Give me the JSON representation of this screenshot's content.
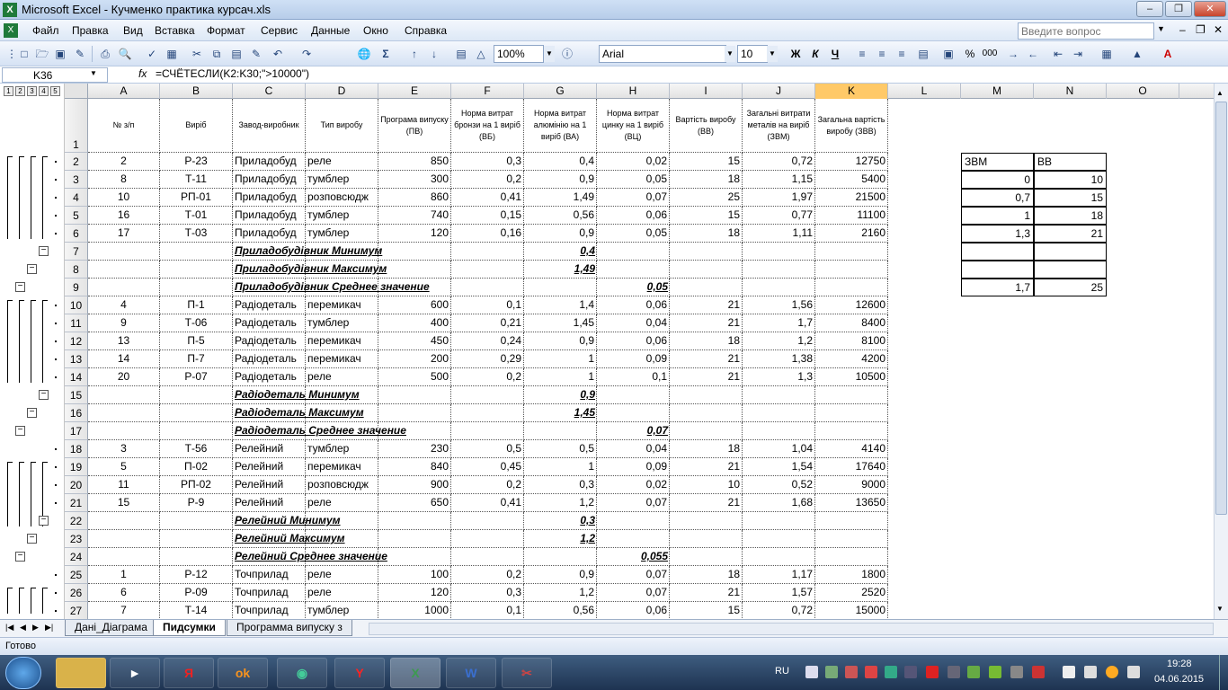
{
  "window": {
    "title": "Microsoft Excel - Кучменко практика курсач.xls",
    "app_icon": "X"
  },
  "menu": [
    "Файл",
    "Правка",
    "Вид",
    "Вставка",
    "Формат",
    "Сервис",
    "Данные",
    "Окно",
    "Справка"
  ],
  "help": {
    "placeholder": "Введите вопрос"
  },
  "toolbar": {
    "zoom": "100%",
    "font": "Arial",
    "size": "10",
    "bold": "Ж",
    "italic": "К",
    "underline": "Ч",
    "percent": "%",
    "thousands": "000"
  },
  "formula_bar": {
    "cell": "K36",
    "fx": "fx",
    "formula": "=СЧЁТЕСЛИ(K2:K30;\">10000\")"
  },
  "outline_levels": [
    "1",
    "2",
    "3",
    "4",
    "5"
  ],
  "columns": [
    "A",
    "B",
    "C",
    "D",
    "E",
    "F",
    "G",
    "H",
    "I",
    "J",
    "K",
    "L",
    "M",
    "N",
    "O"
  ],
  "header_row": [
    "№      з/п",
    "Виріб",
    "Завод-виробник",
    "Тип виробу",
    "Програма випуску (ПВ)",
    "Норма витрат бронзи на 1 виріб (ВБ)",
    "Норма витрат алюмінію на 1 виріб (ВА)",
    "Норма витрат цинку на 1 виріб (ВЦ)",
    "Вартість виробу (ВВ)",
    "Загальні витрати металів на виріб (ЗВМ)",
    "Загальна вартість виробу (ЗВВ)"
  ],
  "rows": [
    {
      "n": "2",
      "t": "d",
      "v": [
        "2",
        "Р-23",
        "Приладобуд",
        "реле",
        "850",
        "0,3",
        "0,4",
        "0,02",
        "15",
        "0,72",
        "12750"
      ]
    },
    {
      "n": "3",
      "t": "d",
      "v": [
        "8",
        "Т-11",
        "Приладобуд",
        "тумблер",
        "300",
        "0,2",
        "0,9",
        "0,05",
        "18",
        "1,15",
        "5400"
      ]
    },
    {
      "n": "4",
      "t": "d",
      "v": [
        "10",
        "РП-01",
        "Приладобуд",
        "розповсюдж",
        "860",
        "0,41",
        "1,49",
        "0,07",
        "25",
        "1,97",
        "21500"
      ]
    },
    {
      "n": "5",
      "t": "d",
      "v": [
        "16",
        "Т-01",
        "Приладобуд",
        "тумблер",
        "740",
        "0,15",
        "0,56",
        "0,06",
        "15",
        "0,77",
        "11100"
      ]
    },
    {
      "n": "6",
      "t": "d",
      "v": [
        "17",
        "Т-03",
        "Приладобуд",
        "тумблер",
        "120",
        "0,16",
        "0,9",
        "0,05",
        "18",
        "1,11",
        "2160"
      ]
    },
    {
      "n": "7",
      "t": "s",
      "label": "Приладобудівник Минимум",
      "col": "G",
      "val": "0,4"
    },
    {
      "n": "8",
      "t": "s",
      "label": "Приладобудівник Максимум",
      "col": "G",
      "val": "1,49"
    },
    {
      "n": "9",
      "t": "s",
      "label": "Приладобудівник Среднее значение",
      "col": "H",
      "val": "0,05"
    },
    {
      "n": "10",
      "t": "d",
      "v": [
        "4",
        "П-1",
        "Радіодеталь",
        "перемикач",
        "600",
        "0,1",
        "1,4",
        "0,06",
        "21",
        "1,56",
        "12600"
      ]
    },
    {
      "n": "11",
      "t": "d",
      "v": [
        "9",
        "Т-06",
        "Радіодеталь",
        "тумблер",
        "400",
        "0,21",
        "1,45",
        "0,04",
        "21",
        "1,7",
        "8400"
      ]
    },
    {
      "n": "12",
      "t": "d",
      "v": [
        "13",
        "П-5",
        "Радіодеталь",
        "перемикач",
        "450",
        "0,24",
        "0,9",
        "0,06",
        "18",
        "1,2",
        "8100"
      ]
    },
    {
      "n": "13",
      "t": "d",
      "v": [
        "14",
        "П-7",
        "Радіодеталь",
        "перемикач",
        "200",
        "0,29",
        "1",
        "0,09",
        "21",
        "1,38",
        "4200"
      ]
    },
    {
      "n": "14",
      "t": "d",
      "v": [
        "20",
        "Р-07",
        "Радіодеталь",
        "реле",
        "500",
        "0,2",
        "1",
        "0,1",
        "21",
        "1,3",
        "10500"
      ]
    },
    {
      "n": "15",
      "t": "s",
      "label": "Радіодеталь Минимум",
      "col": "G",
      "val": "0,9"
    },
    {
      "n": "16",
      "t": "s",
      "label": "Радіодеталь Максимум",
      "col": "G",
      "val": "1,45"
    },
    {
      "n": "17",
      "t": "s",
      "label": "Радіодеталь Среднее значение",
      "col": "H",
      "val": "0,07"
    },
    {
      "n": "18",
      "t": "d",
      "v": [
        "3",
        "Т-56",
        "Релейний",
        "тумблер",
        "230",
        "0,5",
        "0,5",
        "0,04",
        "18",
        "1,04",
        "4140"
      ]
    },
    {
      "n": "19",
      "t": "d",
      "v": [
        "5",
        "П-02",
        "Релейний",
        "перемикач",
        "840",
        "0,45",
        "1",
        "0,09",
        "21",
        "1,54",
        "17640"
      ]
    },
    {
      "n": "20",
      "t": "d",
      "v": [
        "11",
        "РП-02",
        "Релейний",
        "розповсюдж",
        "900",
        "0,2",
        "0,3",
        "0,02",
        "10",
        "0,52",
        "9000"
      ]
    },
    {
      "n": "21",
      "t": "d",
      "v": [
        "15",
        "Р-9",
        "Релейний",
        "реле",
        "650",
        "0,41",
        "1,2",
        "0,07",
        "21",
        "1,68",
        "13650"
      ]
    },
    {
      "n": "22",
      "t": "s",
      "label": "Релейний Минимум",
      "col": "G",
      "val": "0,3"
    },
    {
      "n": "23",
      "t": "s",
      "label": "Релейний Максимум",
      "col": "G",
      "val": "1,2"
    },
    {
      "n": "24",
      "t": "s",
      "label": "Релейний Среднее значение",
      "col": "H",
      "val": "0,055"
    },
    {
      "n": "25",
      "t": "d",
      "v": [
        "1",
        "Р-12",
        "Точприлад",
        "реле",
        "100",
        "0,2",
        "0,9",
        "0,07",
        "18",
        "1,17",
        "1800"
      ]
    },
    {
      "n": "26",
      "t": "d",
      "v": [
        "6",
        "Р-09",
        "Точприлад",
        "реле",
        "120",
        "0,3",
        "1,2",
        "0,07",
        "21",
        "1,57",
        "2520"
      ]
    },
    {
      "n": "27",
      "t": "d",
      "v": [
        "7",
        "Т-14",
        "Точприлад",
        "тумблер",
        "1000",
        "0,1",
        "0,56",
        "0,06",
        "15",
        "0,72",
        "15000"
      ]
    }
  ],
  "side_table": {
    "headers": [
      "ЗВМ",
      "ВВ"
    ],
    "rows": [
      [
        "0",
        "10"
      ],
      [
        "0,7",
        "15"
      ],
      [
        "1",
        "18"
      ],
      [
        "1,3",
        "21"
      ],
      [
        "",
        ""
      ],
      [
        "",
        ""
      ],
      [
        "1,7",
        "25"
      ]
    ]
  },
  "sheets": [
    "Дані_Діаграма",
    "Пидсумки",
    "Программа випуску з"
  ],
  "active_sheet": "Пидсумки",
  "status": "Готово",
  "taskbar": {
    "lang": "RU",
    "time": "19:28",
    "date": "04.06.2015"
  },
  "colors": {
    "accent": "#ffc968",
    "excel_green": "#1f7a3a"
  }
}
